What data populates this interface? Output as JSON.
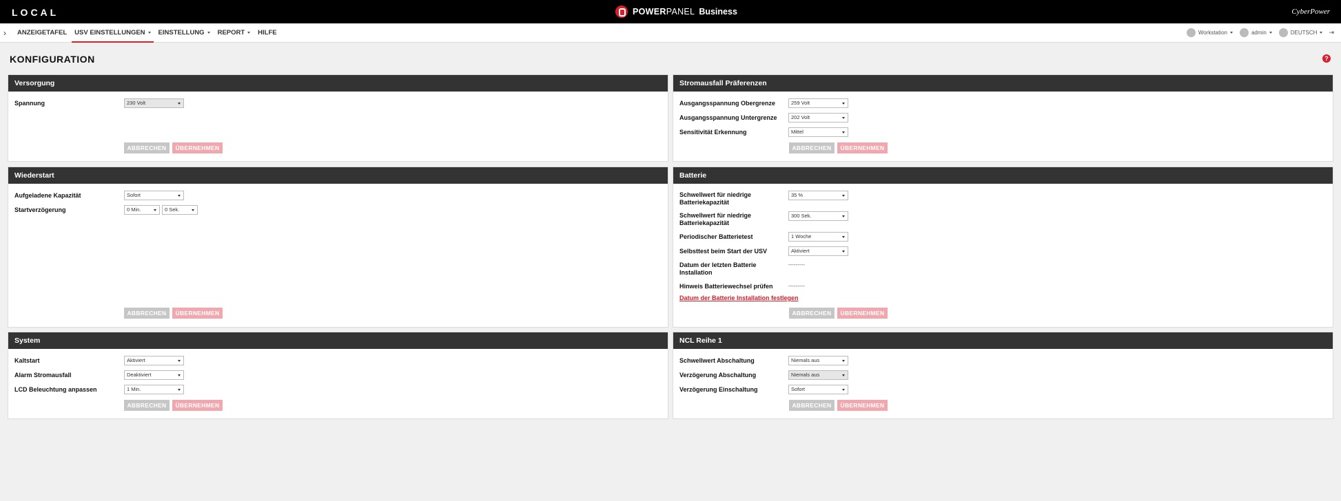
{
  "header": {
    "location": "LOCAL",
    "brand_power": "POWER",
    "brand_panel": "PANEL",
    "brand_suffix": "Business",
    "vendor": "CyberPower"
  },
  "nav": {
    "items": [
      {
        "label": "ANZEIGETAFEL",
        "active": false,
        "dropdown": false
      },
      {
        "label": "USV EINSTELLUNGEN",
        "active": true,
        "dropdown": true
      },
      {
        "label": "EINSTELLUNG",
        "active": false,
        "dropdown": true
      },
      {
        "label": "REPORT",
        "active": false,
        "dropdown": true
      },
      {
        "label": "HILFE",
        "active": false,
        "dropdown": false
      }
    ],
    "workstation": "Workstation",
    "user": "admin",
    "language": "DEUTSCH"
  },
  "page": {
    "title": "KONFIGURATION"
  },
  "buttons": {
    "cancel": "ABBRECHEN",
    "apply": "ÜBERNEHMEN"
  },
  "panels": {
    "versorgung": {
      "title": "Versorgung",
      "spannung_label": "Spannung",
      "spannung_value": "230 Volt"
    },
    "stromausfall": {
      "title": "Stromausfall Präferenzen",
      "obergrenze_label": "Ausgangsspannung Obergrenze",
      "obergrenze_value": "259 Volt",
      "untergrenze_label": "Ausgangsspannung Untergrenze",
      "untergrenze_value": "202 Volt",
      "sensitivitaet_label": "Sensitivität Erkennung",
      "sensitivitaet_value": "Mittel"
    },
    "wiederstart": {
      "title": "Wiederstart",
      "kapazitaet_label": "Aufgeladene Kapazität",
      "kapazitaet_value": "Sofort",
      "verzoegerung_label": "Startverzögerung",
      "verzoegerung_min": "0 Min.",
      "verzoegerung_sek": "0 Sek."
    },
    "batterie": {
      "title": "Batterie",
      "schwell1_label_a": "Schwellwert für niedrige",
      "schwell1_label_b": "Batteriekapazität",
      "schwell1_value": "35 %",
      "schwell2_label_a": "Schwellwert für niedrige",
      "schwell2_label_b": "Batteriekapazität",
      "schwell2_value": "300 Sek.",
      "periodisch_label": "Periodischer Batterietest",
      "periodisch_value": "1 Woche",
      "selbsttest_label": "Selbsttest beim Start der USV",
      "selbsttest_value": "Aktiviert",
      "datum_label_a": "Datum der letzten Batterie",
      "datum_label_b": "Installation",
      "datum_value": "---------",
      "hinweis_label": "Hinweis Batteriewechsel prüfen",
      "hinweis_value": "---------",
      "link": "Datum der Batterie Installation festlegen"
    },
    "system": {
      "title": "System",
      "kaltstart_label": "Kaltstart",
      "kaltstart_value": "Aktiviert",
      "alarm_label": "Alarm Stromausfall",
      "alarm_value": "Deaktiviert",
      "lcd_label": "LCD Beleuchtung anpassen",
      "lcd_value": "1 Min."
    },
    "ncl": {
      "title": "NCL Reihe 1",
      "schwell_label": "Schwellwert Abschaltung",
      "schwell_value": "Niemals aus",
      "abschalt_label": "Verzögerung Abschaltung",
      "abschalt_value": "Niemals aus",
      "einschalt_label": "Verzögerung Einschaltung",
      "einschalt_value": "Sofort"
    }
  }
}
